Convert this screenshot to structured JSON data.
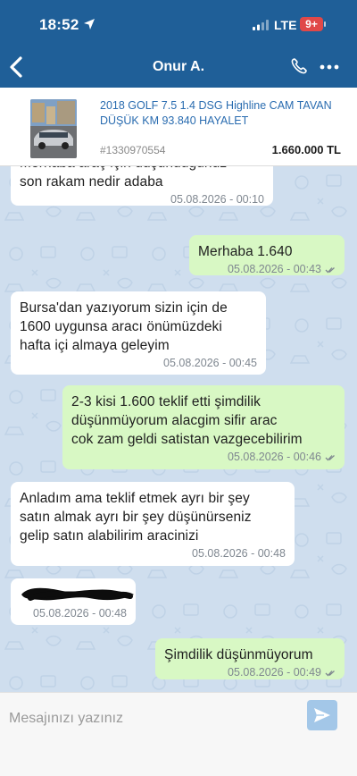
{
  "status_bar": {
    "time": "18:52",
    "network": "LTE",
    "battery": "9+"
  },
  "header": {
    "title": "Onur A."
  },
  "listing": {
    "title": "2018 GOLF 7.5 1.4 DSG Highline CAM TAVAN DÜŞÜK KM 93.840 HAYALET",
    "id": "#1330970554",
    "price": "1.660.000 TL"
  },
  "messages": [
    {
      "direction": "in",
      "text": "Merhaba araç için düşündüğünüz\nson rakam nedir adaba",
      "time": "05.08.2026 - 00:10"
    },
    {
      "direction": "out",
      "text": "Merhaba 1.640",
      "time": "05.08.2026 - 00:43"
    },
    {
      "direction": "in",
      "text": "Bursa'dan yazıyorum sizin için de\n1600 uygunsa aracı önümüzdeki\nhafta içi almaya geleyim",
      "time": "05.08.2026 - 00:45"
    },
    {
      "direction": "out",
      "text": "2-3 kisi 1.600 teklif etti şimdilik\ndüşünmüyorum alacgim sifir arac\ncok zam geldi satistan vazgecebilirim",
      "time": "05.08.2026 - 00:46"
    },
    {
      "direction": "in",
      "text": "Anladım ama teklif etmek ayrı bir şey\nsatın almak ayrı bir şey düşünürseniz\ngelip satın alabilirim aracinizi",
      "time": "05.08.2026 - 00:48"
    },
    {
      "direction": "in",
      "text": "",
      "time": "05.08.2026 - 00:48"
    },
    {
      "direction": "out",
      "text": "Şimdilik düşünmüyorum",
      "time": "05.08.2026 - 00:49"
    }
  ],
  "composer": {
    "placeholder": "Mesajınızı yazınız"
  },
  "colors": {
    "header": "#1f5f98",
    "chat_bg": "#cfdeee",
    "incoming": "#ffffff",
    "outgoing": "#d8f8c4",
    "link": "#2a6cb0",
    "battery": "#e04848"
  },
  "icons": {
    "back": "chevron-left-icon",
    "call": "phone-icon",
    "more": "more-icon",
    "send": "send-icon"
  }
}
